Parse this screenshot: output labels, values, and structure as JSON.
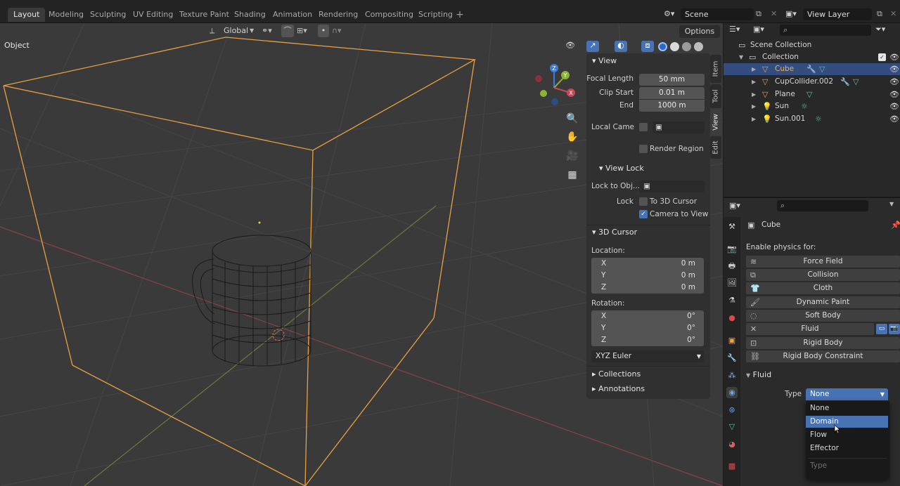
{
  "workspace_tabs": [
    "Layout",
    "Modeling",
    "Sculpting",
    "UV Editing",
    "Texture Paint",
    "Shading",
    "Animation",
    "Rendering",
    "Compositing",
    "Scripting"
  ],
  "add_workspace": "+",
  "scene": {
    "label": "Scene"
  },
  "view_layer": {
    "label": "View Layer"
  },
  "viewport": {
    "mode": "Object",
    "orientation": "Global",
    "options_label": "Options",
    "gizmo": {
      "x": "X",
      "y": "Y",
      "z": "Z"
    }
  },
  "npanel": {
    "view_section": "View",
    "focal_length_label": "Focal Length",
    "focal_length_value": "50 mm",
    "clip_start_label": "Clip Start",
    "clip_start_value": "0.01 m",
    "end_label": "End",
    "end_value": "1000 m",
    "local_camera_label": "Local Came",
    "render_region_label": "Render Region",
    "view_lock_section": "View Lock",
    "lock_to_obj_label": "Lock to Obj...",
    "lock_label": "Lock",
    "to_3d_cursor_label": "To 3D Cursor",
    "camera_to_view_label": "Camera to View",
    "cursor_section": "3D Cursor",
    "location_label": "Location:",
    "location": [
      {
        "axis": "X",
        "value": "0 m"
      },
      {
        "axis": "Y",
        "value": "0 m"
      },
      {
        "axis": "Z",
        "value": "0 m"
      }
    ],
    "rotation_label": "Rotation:",
    "rotation": [
      {
        "axis": "X",
        "value": "0°"
      },
      {
        "axis": "Y",
        "value": "0°"
      },
      {
        "axis": "Z",
        "value": "0°"
      }
    ],
    "rotation_mode": "XYZ Euler",
    "collections_section": "Collections",
    "annotations_section": "Annotations",
    "tabs": [
      "Item",
      "Tool",
      "View",
      "Edit"
    ]
  },
  "outliner": {
    "scene_collection": "Scene Collection",
    "collection": "Collection",
    "objects": [
      "Cube",
      "CupCollider.002",
      "Plane",
      "Sun",
      "Sun.001"
    ]
  },
  "properties": {
    "object_name": "Cube",
    "enable_physics_label": "Enable physics for:",
    "physics_buttons": [
      "Force Field",
      "Collision",
      "Cloth",
      "Dynamic Paint",
      "Soft Body",
      "Fluid",
      "Rigid Body",
      "Rigid Body Constraint"
    ],
    "fluid_section": "Fluid",
    "type_label": "Type",
    "type_value": "None"
  },
  "dropdown": {
    "options": [
      "None",
      "Domain",
      "Flow",
      "Effector"
    ],
    "highlighted": "Domain",
    "title": "Type"
  },
  "colors": {
    "accent": "#4772b3",
    "selection": "#334d80",
    "wire_orange": "#e8a040",
    "x_axis": "#c8485a",
    "y_axis": "#8ab62f",
    "z_axis": "#3d7ad9"
  }
}
